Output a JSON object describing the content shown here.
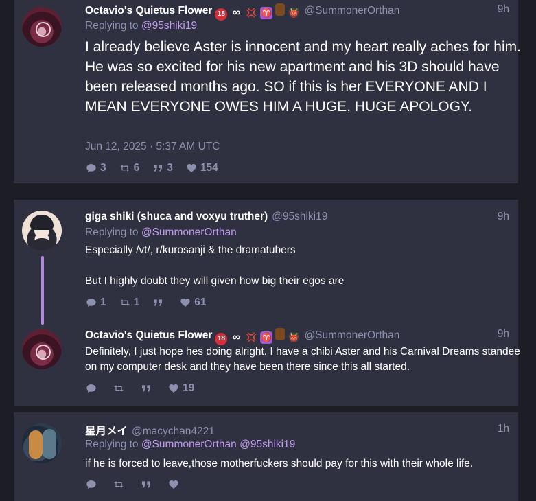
{
  "post1": {
    "display_name": "Octavio's Quietus Flower",
    "handle": "@SummonerOrthan",
    "time": "9h",
    "replying_label": "Replying to",
    "replying_to": "@95shiki19",
    "text": "I already believe Aster is innocent and my heart really aches for him. He was so excited for his new apartment and his 3D should have been released months ago. SO if this is her EVERYONE AND I MEAN EVERYONE OWES HIM A HUGE, HUGE APOLOGY.",
    "date": "Jun 12, 2025 · 5:37 AM UTC",
    "stats": {
      "replies": "3",
      "retweets": "6",
      "quotes": "3",
      "likes": "154"
    }
  },
  "post2": {
    "display_name": "giga shiki (shuca and voxyu truther)",
    "handle": "@95shiki19",
    "time": "9h",
    "replying_label": "Replying to",
    "replying_to": "@SummonerOrthan",
    "text_line1": "Especially /vt/, r/kurosanji & the dramatubers",
    "text_line2": "But I highly doubt they will given how big their egos are",
    "stats": {
      "replies": "1",
      "retweets": "1",
      "quotes": "",
      "likes": "61"
    }
  },
  "post3": {
    "display_name": "Octavio's Quietus Flower",
    "handle": "@SummonerOrthan",
    "time": "9h",
    "text": "Definitely, I just hope hes doing alright. I have a chibi Aster and his Carnival Dreams standee on my computer desk and they have been there since this all started.",
    "stats": {
      "replies": "",
      "retweets": "",
      "quotes": "",
      "likes": "19"
    }
  },
  "post4": {
    "display_name": "星月メイ",
    "handle": "@macychan4221",
    "time": "1h",
    "replying_label": "Replying to",
    "replying_to_1": "@SummonerOrthan",
    "replying_to_2": "@95shiki19",
    "text": "if he is forced to leave,those motherfuckers should pay for this with their whole life.",
    "stats": {
      "replies": "",
      "retweets": "",
      "quotes": "",
      "likes": ""
    }
  },
  "emoji": {
    "age18": "18",
    "infinity": "∞",
    "anger": "💢",
    "aries": "♈",
    "devil": "👹"
  },
  "colors": {
    "background": "#1c1d25",
    "card": "#2f3141",
    "accent": "#c299f0",
    "muted": "#8d91ae",
    "thread_line": "#b48ae0"
  }
}
